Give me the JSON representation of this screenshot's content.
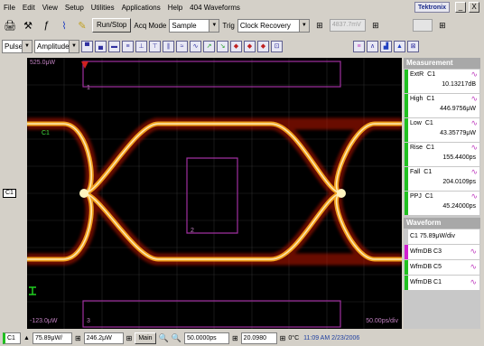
{
  "menu": [
    "File",
    "Edit",
    "View",
    "Setup",
    "Utilities",
    "Applications",
    "Help",
    "404 Waveforms"
  ],
  "brand": "Tektronix",
  "window_buttons": [
    "_",
    "X"
  ],
  "toolbar1": {
    "run_stop": "Run/Stop",
    "acq_label": "Acq Mode",
    "acq_value": "Sample",
    "trig_label": "Trig",
    "trig_value": "Clock Recovery",
    "gray_value": "4837.7mV"
  },
  "toolbar2": {
    "mode1": "Pulse",
    "mode2": "Amplitude"
  },
  "screen": {
    "top_left": "525.0μW",
    "bottom_left": "-123.0μW",
    "bottom_right": "50.00ps/div",
    "channel": "C1",
    "mask_label_1": "1",
    "mask_label_2": "2",
    "mask_label_3": "3"
  },
  "side_marker": "C1",
  "measurements_title": "Measurement",
  "measurements": [
    {
      "name": "ExtR",
      "ch": "C1",
      "value": "10.13217dB"
    },
    {
      "name": "High",
      "ch": "C1",
      "value": "446.9756μW"
    },
    {
      "name": "Low",
      "ch": "C1",
      "value": "43.35779μW"
    },
    {
      "name": "Rise",
      "ch": "C1",
      "value": "155.4400ps"
    },
    {
      "name": "Fall",
      "ch": "C1",
      "value": "204.0109ps"
    },
    {
      "name": "PPJ",
      "ch": "C1",
      "value": "45.24000ps"
    }
  ],
  "waveform_title": "Waveform",
  "waveform_scale": "C1 75.89μW/div",
  "waveforms": [
    {
      "label": "WfmDB C3",
      "color": "#d020d0"
    },
    {
      "label": "WfmDB C5",
      "color": "#20c020"
    },
    {
      "label": "WfmDB C1",
      "color": "#20c020"
    }
  ],
  "status": {
    "channel": "C1",
    "scale": "75.89μW/",
    "offset": "246.2μW",
    "main_label": "Main",
    "time_div": "50.0000ps",
    "position": "20.0980",
    "temp": "0°C",
    "clock": "11:09 AM 2/23/2006"
  }
}
